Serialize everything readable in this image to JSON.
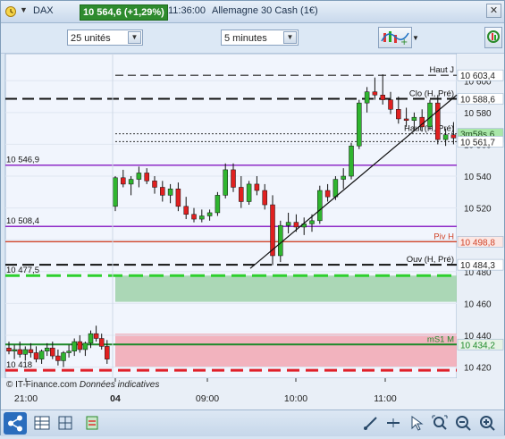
{
  "title": {
    "symbol": "DAX",
    "price_change": "10 564,6 (+1,29%)",
    "time": "11:36:00",
    "instrument": "Allemagne 30 Cash (1€)"
  },
  "toolbar": {
    "units_value": "25 unités",
    "interval_value": "5 minutes"
  },
  "footer": {
    "copyright": "© IT-Finance.com",
    "disclaimer": "Données indicatives"
  },
  "colors": {
    "bull": "#2fb52f",
    "bear": "#e02020",
    "accent_purple": "#8e2bc8",
    "accent_red": "#d0452a",
    "accent_green": "#1e8a2a",
    "zone_green": "#9fd1a9",
    "zone_red": "#f2a7b3",
    "background": "#f1f5fd"
  },
  "chart_data": {
    "type": "candlestick",
    "y_range": [
      10413,
      10617
    ],
    "y_ticks": [
      {
        "value": 10420,
        "label": "10 420"
      },
      {
        "value": 10440,
        "label": "10 440"
      },
      {
        "value": 10460,
        "label": "10 460"
      },
      {
        "value": 10480,
        "label": "10 480"
      },
      {
        "value": 10500,
        "label": "10 500"
      },
      {
        "value": 10520,
        "label": "10 520"
      },
      {
        "value": 10540,
        "label": "10 540"
      },
      {
        "value": 10560,
        "label": "10 560"
      },
      {
        "value": 10580,
        "label": "10 580"
      },
      {
        "value": 10600,
        "label": "10 600"
      }
    ],
    "x_ticks": [
      "21:00",
      "04",
      "09:00",
      "10:00",
      "11:00"
    ],
    "levels": [
      {
        "value": 10603.4,
        "tag": "Haut J",
        "price_label": "10 603,4",
        "style": "dash-thin"
      },
      {
        "value": 10588.6,
        "tag": "Clo (H, Pré)",
        "price_label": "10 588,6",
        "style": "dash-thick"
      },
      {
        "value": 10564.6,
        "tag": "",
        "price_label": "10 564,6",
        "style": "current"
      },
      {
        "value": 10566.6,
        "tag": "Haut (H, Pré)",
        "price_label": "3m58s 6",
        "style": "dot"
      },
      {
        "value": 10561.7,
        "tag": "",
        "price_label": "10 561,7",
        "style": "dot"
      },
      {
        "value": 10546.9,
        "tag": "10 546,9",
        "price_label": "",
        "style": "purple"
      },
      {
        "value": 10508.4,
        "tag": "10 508,4",
        "price_label": "",
        "style": "purple"
      },
      {
        "value": 10498.8,
        "tag": "Piv H",
        "price_label": "10 498,8",
        "style": "red"
      },
      {
        "value": 10484.3,
        "tag": "Ouv (H, Pré)",
        "price_label": "10 484,3",
        "style": "dash-thick"
      },
      {
        "value": 10477.5,
        "tag": "10 477,5",
        "price_label": "",
        "style": "green-dash"
      },
      {
        "value": 10434.2,
        "tag": "mS1 M",
        "price_label": "10 434,2",
        "style": "green"
      },
      {
        "value": 10418,
        "tag": "10 418",
        "price_label": "",
        "style": "red-dash"
      }
    ],
    "zones": [
      {
        "from": 10461,
        "to": 10477.5,
        "color": "green"
      },
      {
        "from": 10420,
        "to": 10441,
        "color": "red"
      }
    ],
    "candles_overnight": [
      [
        10432,
        10436,
        10428,
        10430
      ],
      [
        10430,
        10434,
        10425,
        10431
      ],
      [
        10431,
        10436,
        10426,
        10428
      ],
      [
        10428,
        10433,
        10424,
        10431
      ],
      [
        10431,
        10435,
        10426,
        10429
      ],
      [
        10429,
        10433,
        10423,
        10425
      ],
      [
        10425,
        10431,
        10422,
        10430
      ],
      [
        10430,
        10435,
        10427,
        10432
      ],
      [
        10432,
        10436,
        10425,
        10427
      ],
      [
        10427,
        10431,
        10421,
        10424
      ],
      [
        10424,
        10430,
        10420,
        10429
      ],
      [
        10429,
        10434,
        10426,
        10430
      ],
      [
        10430,
        10438,
        10427,
        10436
      ],
      [
        10436,
        10440,
        10429,
        10431
      ],
      [
        10431,
        10436,
        10427,
        10435
      ],
      [
        10435,
        10443,
        10432,
        10441
      ],
      [
        10441,
        10446,
        10436,
        10438
      ],
      [
        10438,
        10441,
        10431,
        10433
      ],
      [
        10433,
        10437,
        10422,
        10425
      ]
    ],
    "candles_session": [
      [
        10521,
        10540,
        10518,
        10539
      ],
      [
        10539,
        10544,
        10533,
        10535
      ],
      [
        10535,
        10540,
        10528,
        10538
      ],
      [
        10538,
        10546,
        10533,
        10542
      ],
      [
        10542,
        10545,
        10535,
        10537
      ],
      [
        10537,
        10540,
        10529,
        10533
      ],
      [
        10533,
        10537,
        10524,
        10528
      ],
      [
        10528,
        10535,
        10523,
        10532
      ],
      [
        10532,
        10536,
        10518,
        10521
      ],
      [
        10521,
        10527,
        10513,
        10516
      ],
      [
        10516,
        10520,
        10511,
        10513
      ],
      [
        10513,
        10519,
        10511,
        10515
      ],
      [
        10515,
        10519,
        10512,
        10517
      ],
      [
        10517,
        10530,
        10515,
        10528
      ],
      [
        10528,
        10548,
        10526,
        10544
      ],
      [
        10544,
        10548,
        10530,
        10533
      ],
      [
        10533,
        10540,
        10520,
        10524
      ],
      [
        10524,
        10537,
        10522,
        10535
      ],
      [
        10535,
        10540,
        10528,
        10531
      ],
      [
        10531,
        10535,
        10519,
        10522
      ],
      [
        10522,
        10528,
        10484,
        10490
      ],
      [
        10490,
        10512,
        10486,
        10509
      ],
      [
        10509,
        10517,
        10504,
        10511
      ],
      [
        10511,
        10516,
        10505,
        10508
      ],
      [
        10508,
        10514,
        10503,
        10510
      ],
      [
        10510,
        10516,
        10505,
        10512
      ],
      [
        10512,
        10534,
        10510,
        10531
      ],
      [
        10531,
        10535,
        10524,
        10527
      ],
      [
        10527,
        10540,
        10525,
        10538
      ],
      [
        10538,
        10545,
        10532,
        10540
      ],
      [
        10540,
        10561,
        10538,
        10559
      ],
      [
        10559,
        10588,
        10557,
        10586
      ],
      [
        10586,
        10596,
        10580,
        10593
      ],
      [
        10593,
        10602,
        10588,
        10591
      ],
      [
        10591,
        10604,
        10585,
        10588
      ],
      [
        10588,
        10593,
        10579,
        10582
      ],
      [
        10582,
        10590,
        10573,
        10576
      ],
      [
        10576,
        10583,
        10571,
        10575
      ],
      [
        10575,
        10580,
        10569,
        10577
      ],
      [
        10577,
        10582,
        10568,
        10571
      ],
      [
        10571,
        10588,
        10569,
        10586
      ],
      [
        10586,
        10591,
        10560,
        10563
      ],
      [
        10563,
        10570,
        10559,
        10566
      ],
      [
        10566,
        10574,
        10560,
        10564
      ]
    ]
  }
}
